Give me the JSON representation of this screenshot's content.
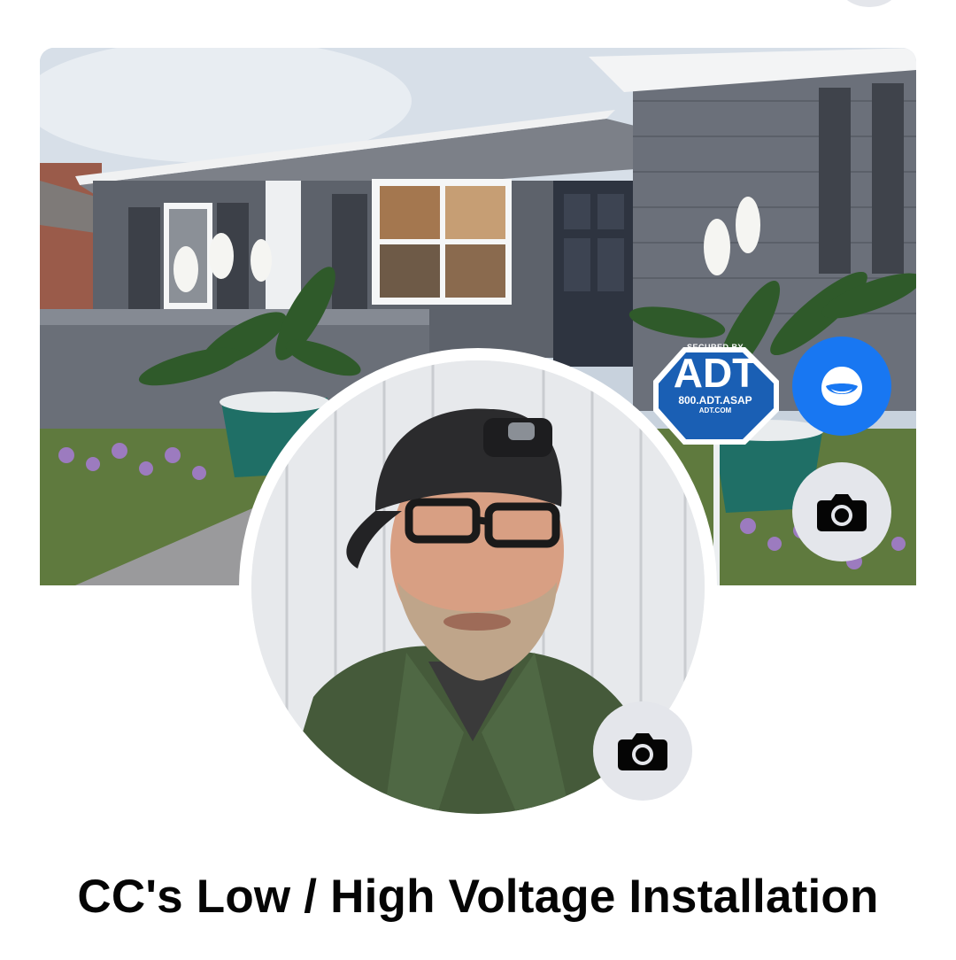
{
  "profile": {
    "page_name": "CC's Low / High Voltage Installation"
  },
  "cover": {
    "sign": {
      "top_text": "SECURED BY",
      "brand": "ADT",
      "phone": "800.ADT.ASAP",
      "site": "ADT.COM"
    }
  },
  "icons": {
    "ai_assistant": "meta-ai-icon",
    "cover_camera": "camera-icon",
    "profile_camera": "camera-icon"
  },
  "colors": {
    "accent": "#1877f2",
    "button_bg": "#e4e6eb",
    "sign_blue": "#1a5fb4",
    "text": "#050505"
  }
}
